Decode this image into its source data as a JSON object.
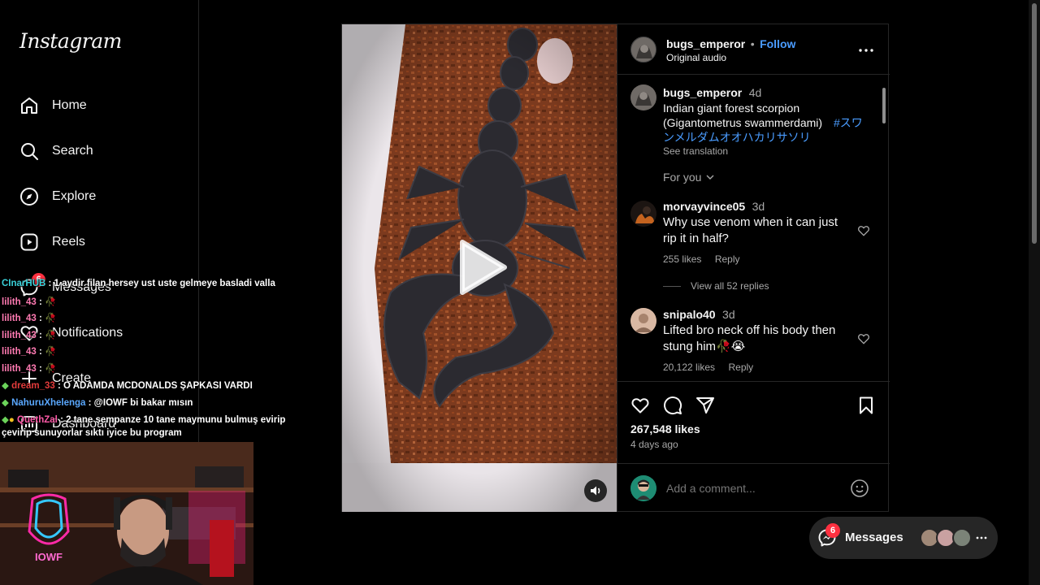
{
  "app": {
    "logo": "Instagram"
  },
  "sidebar": {
    "items": [
      {
        "label": "Home",
        "icon": "home-icon"
      },
      {
        "label": "Search",
        "icon": "search-icon"
      },
      {
        "label": "Explore",
        "icon": "compass-icon"
      },
      {
        "label": "Reels",
        "icon": "reels-icon"
      },
      {
        "label": "Messages",
        "icon": "messenger-icon",
        "badge": "6"
      },
      {
        "label": "Notifications",
        "icon": "heart-icon"
      },
      {
        "label": "Create",
        "icon": "plus-icon"
      },
      {
        "label": "Dashboard",
        "icon": "dashboard-icon"
      }
    ]
  },
  "post": {
    "author": "bugs_emperor",
    "follow_label": "Follow",
    "dot": "•",
    "audio": "Original audio",
    "caption": {
      "username": "bugs_emperor",
      "time": "4d",
      "text": "Indian giant forest scorpion (Gigantometrus swammerdami)",
      "hashtag": "#スワンメルダムオオハカリサソリ",
      "see_translation": "See translation"
    },
    "sort_label": "For you",
    "comments": [
      {
        "username": "morvayvince05",
        "time": "3d",
        "text": "Why use venom when it can just rip it in half?",
        "likes": "255 likes",
        "reply": "Reply",
        "view_replies": "View all 52 replies"
      },
      {
        "username": "snipalo40",
        "time": "3d",
        "text": "Lifted bro neck off his body then stung him🥀😭",
        "likes": "20,122 likes",
        "reply": "Reply"
      }
    ],
    "likes": "267,548 likes",
    "posted": "4 days ago",
    "add_comment_placeholder": "Add a comment..."
  },
  "chat": [
    {
      "user": "CInarHUB",
      "color": "#39d0d8",
      "text": ": 1 aydir filan hersey ust uste gelmeye basladi valla"
    },
    {
      "user": "lilith_43",
      "color": "#ff7ab2",
      "text": ": 🥀"
    },
    {
      "user": "lilith_43",
      "color": "#ff7ab2",
      "text": ": 🥀"
    },
    {
      "user": "lilith_43",
      "color": "#ff7ab2",
      "text": ": 🥀"
    },
    {
      "user": "lilith_43",
      "color": "#ff7ab2",
      "text": ": 🥀"
    },
    {
      "user": "lilith_43",
      "color": "#ff7ab2",
      "text": ": 🥀"
    },
    {
      "user": "dream_33",
      "color": "#e33b3b",
      "text": ": O ADAMDA MCDONALDS ŞAPKASI VARDI"
    },
    {
      "user": "NahuruXhelenga",
      "color": "#5aa8ff",
      "text": ": @IOWF bi bakar mısın"
    },
    {
      "user": "QuethZal",
      "color": "#ff5aa8",
      "text": ": 2 tane şempanze 10 tane maymunu bulmuş evirip"
    },
    {
      "user": "",
      "color": "#ffffff",
      "text": "çevirip sunuyorlar sıktı iyice bu program"
    }
  ],
  "webcam": {
    "logo_text": "IOWF"
  },
  "messages_pill": {
    "label": "Messages",
    "badge": "6"
  },
  "colors": {
    "background": "#000000",
    "link": "#4a9cff",
    "accent": "#0095f6",
    "badge": "#ff3040",
    "muted": "#a8a8a8"
  }
}
